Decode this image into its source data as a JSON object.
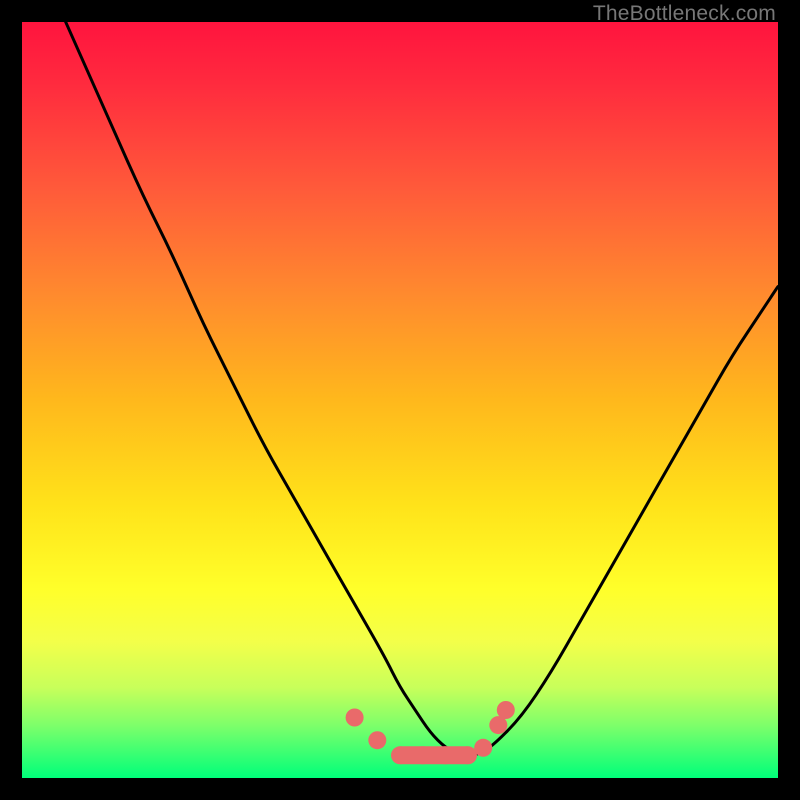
{
  "watermark": "TheBottleneck.com",
  "chart_data": {
    "type": "line",
    "title": "",
    "xlabel": "",
    "ylabel": "",
    "xlim": [
      0,
      100
    ],
    "ylim": [
      0,
      100
    ],
    "x": [
      0,
      4,
      8,
      12,
      16,
      20,
      24,
      28,
      32,
      36,
      40,
      44,
      48,
      50,
      52,
      54,
      56,
      58,
      60,
      62,
      66,
      70,
      74,
      78,
      82,
      86,
      90,
      94,
      98,
      100
    ],
    "values": [
      113,
      104,
      95,
      86,
      77,
      69,
      60,
      52,
      44,
      37,
      30,
      23,
      16,
      12,
      9,
      6,
      4,
      3,
      3,
      4,
      8,
      14,
      21,
      28,
      35,
      42,
      49,
      56,
      62,
      65
    ],
    "series_name": "bottleneck-curve",
    "gradient_stops": [
      {
        "pos": 0,
        "color": "#ff143e"
      },
      {
        "pos": 50,
        "color": "#ffb81c"
      },
      {
        "pos": 75,
        "color": "#ffff2a"
      },
      {
        "pos": 100,
        "color": "#00ff7a"
      }
    ],
    "markers": {
      "color": "#e96a6a",
      "points_x": [
        44,
        47,
        50,
        53,
        56,
        59,
        61,
        63,
        64
      ],
      "points_y": [
        8,
        5,
        3,
        3,
        3,
        3,
        4,
        7,
        9
      ]
    }
  }
}
